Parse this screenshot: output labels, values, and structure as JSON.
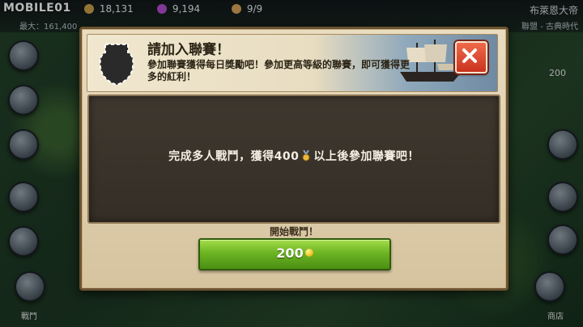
{
  "watermark": "MOBILE01",
  "top_bar": {
    "resource_1": "18,131",
    "resource_1_sub": "最大：161,400",
    "resource_2": "9,194",
    "resource_3": "9/9",
    "right_title": "布萊恩大帝",
    "right_sub": "聯盟 - 古典時代"
  },
  "side": {
    "right_count": "200",
    "left_bottom_label": "戰鬥",
    "right_bottom_label": "商店"
  },
  "dialog": {
    "title": "請加入聯賽！",
    "subtitle": "參加聯賽獲得每日獎勵吧！參加更高等級的聯賽，即可獲得更多的紅利！",
    "message_pre": "完成多人戰鬥，獲得400",
    "message_post": "以上後參加聯賽吧！",
    "start_label": "開始戰鬥！",
    "start_cost": "200"
  },
  "colors": {
    "dialog_bg": "#d6c39e",
    "panel_bg": "#3a332a",
    "button_green": "#6cb423",
    "close_red": "#d9432c",
    "coin_gold": "#f1c21b"
  }
}
